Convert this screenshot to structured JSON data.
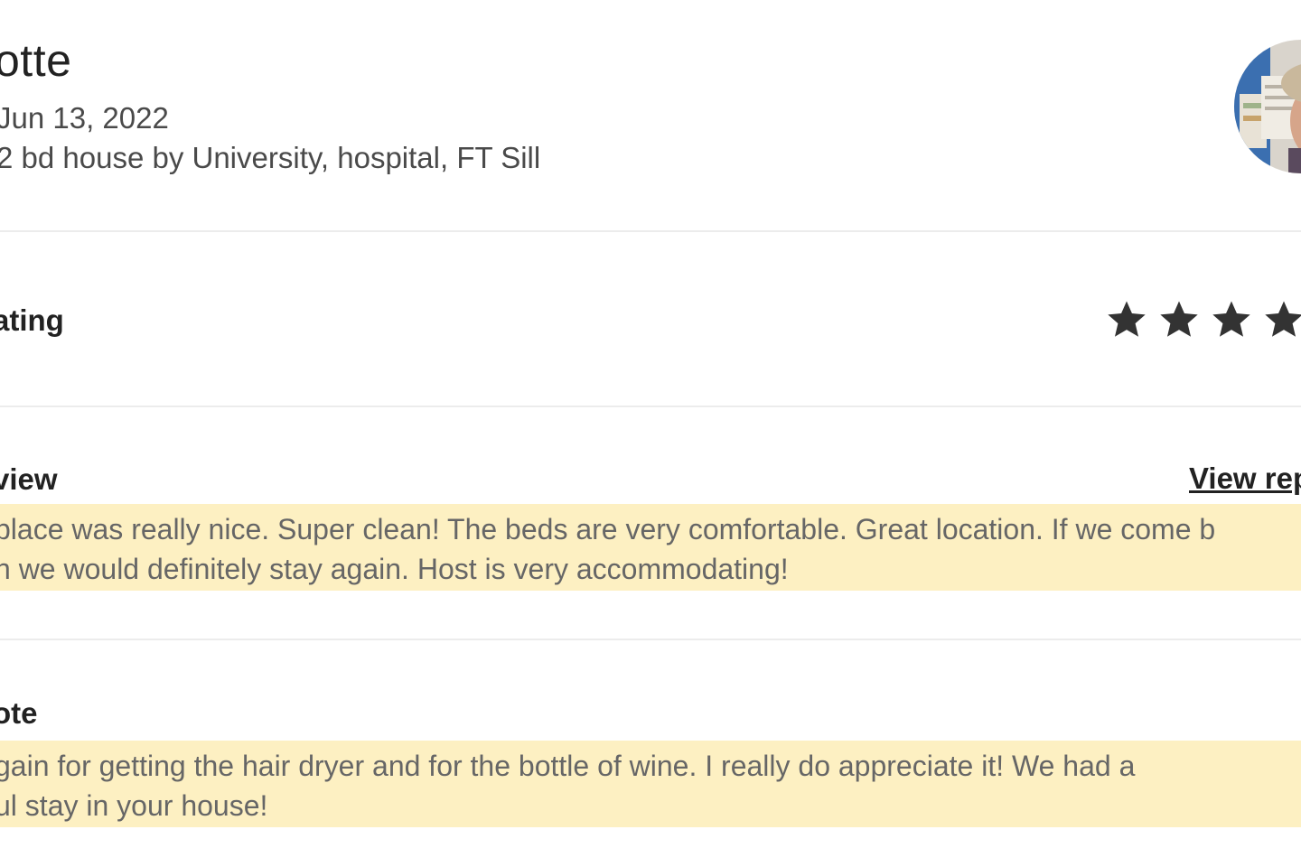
{
  "guest": {
    "name": "otte",
    "date": "Jun 13, 2022",
    "listing": "2 bd house by University, hospital, FT Sill"
  },
  "avatar": {
    "icon": "guest-avatar-photo"
  },
  "rating": {
    "label": "ating",
    "stars_visible": 4,
    "icon": "star-icon",
    "star_color": "#333333"
  },
  "review": {
    "label": "view",
    "link": "View rep",
    "line1": "place was really nice. Super clean! The beds are very comfortable. Great location. If we come b",
    "line2": "n we would definitely stay again. Host is very accommodating!"
  },
  "note": {
    "label": "ote",
    "line1": "gain for getting the hair dryer and for the bottle of wine. I really do appreciate it! We had a",
    "line2": "ul stay in your house!"
  },
  "colors": {
    "highlight": "#fdf0c2",
    "text_muted": "#666666",
    "text_primary": "#222222"
  }
}
